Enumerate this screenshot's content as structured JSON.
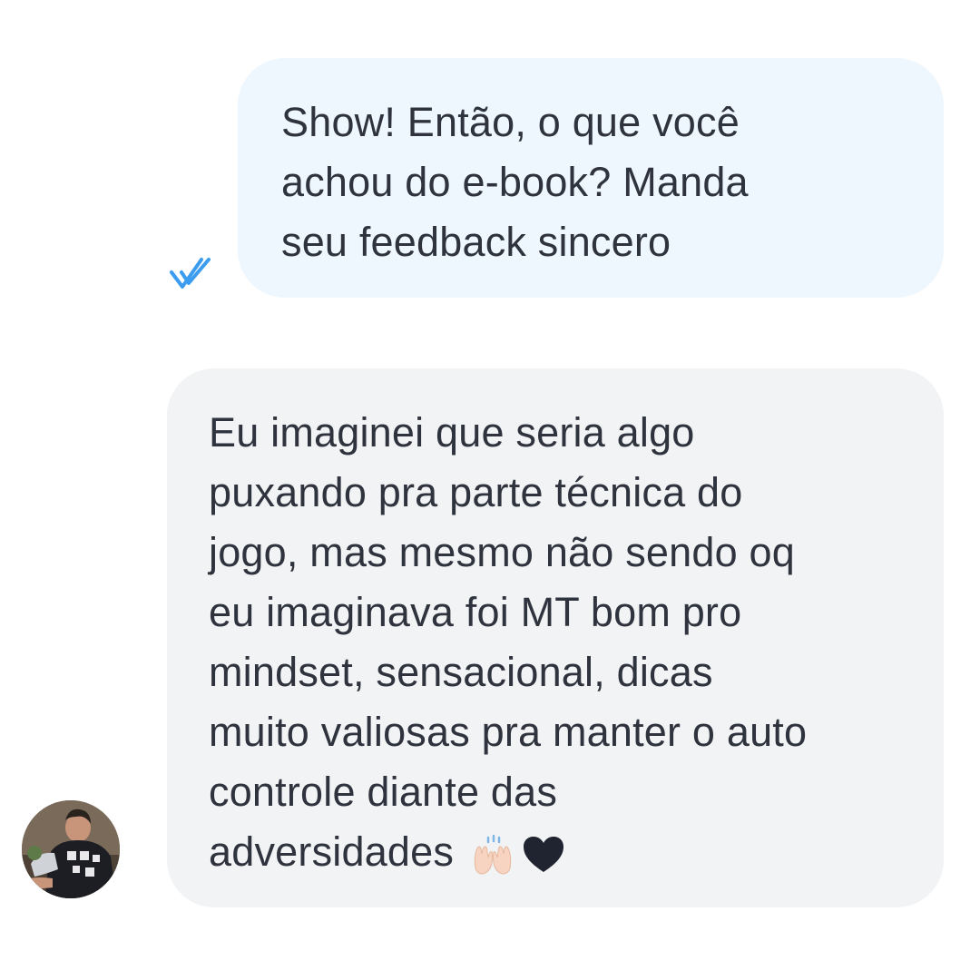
{
  "outgoing_message": {
    "text": "Show! Então, o que você\nachou do e-book? Manda\nseu feedback sincero",
    "status_icon": "double-check-icon",
    "status_color": "#3b9cf0",
    "bubble_color": "#eef6fe"
  },
  "incoming_message": {
    "text": "Eu imaginei que seria algo\npuxando pra parte técnica do\njogo, mas mesmo não sendo oq\neu imaginava foi MT bom pro\nmindset, sensacional, dicas\nmuito valiosas pra manter o auto\ncontrole diante das\nadversidades",
    "emojis": [
      "raising-hands-icon",
      "black-heart-icon"
    ],
    "bubble_color": "#f2f3f5",
    "sender_avatar": "user-avatar"
  }
}
